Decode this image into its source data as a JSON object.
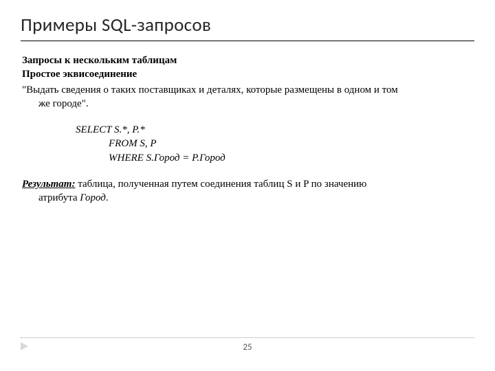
{
  "title": "Примеры SQL-запросов",
  "section": {
    "heading1": "Запросы к нескольким таблицам",
    "heading2": "Простое эквисоединение",
    "quote_line1": "\"Выдать сведения о таких поставщиках и деталях, которые размещены в одном и том",
    "quote_line2": "же городе\"."
  },
  "code": {
    "line1": "SELECT  S.*,  P.*",
    "line2": "FROM   S, P",
    "line3": "WHERE  S.Город = P.Город"
  },
  "result": {
    "label": "Результат:",
    "text1": " таблица, полученная путем соединения таблиц S и P по значению",
    "text2_prefix": "атрибута ",
    "attr": "Город",
    "text2_suffix": "."
  },
  "page_number": "25"
}
